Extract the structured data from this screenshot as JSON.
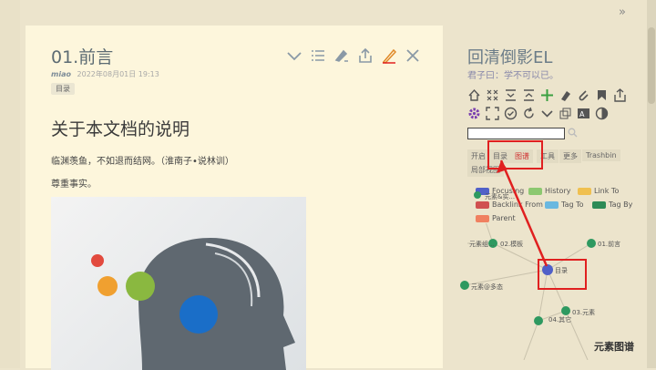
{
  "note": {
    "title": "01.前言",
    "author": "miao",
    "date": "2022年08月01日 19:13",
    "tag": "目录",
    "heading": "关于本文档的说明",
    "paragraphs": [
      "临渊羡鱼，不如退而结网。（淮南子•说林训）",
      "尊重事实。"
    ]
  },
  "sidebar": {
    "title": "回清倒影EL",
    "subtitle": "君子曰：学不可以已。",
    "tabs": [
      "开启",
      "目录",
      "图谱",
      "工具",
      "更多",
      "Trashbin",
      "局部视图"
    ],
    "active_tab": "图谱"
  },
  "legend": [
    {
      "label": "Focusing",
      "color": "#5060c8"
    },
    {
      "label": "History",
      "color": "#8cc870"
    },
    {
      "label": "Link To",
      "color": "#f0c050"
    },
    {
      "label": "Backlink From",
      "color": "#d05050"
    },
    {
      "label": "Tag To",
      "color": "#6ab8e0"
    },
    {
      "label": "Tag By",
      "color": "#2e8b57"
    },
    {
      "label": "Parent",
      "color": "#f08060"
    }
  ],
  "graph": {
    "nodes": [
      "元素&实...",
      "元素组...",
      "02.模板",
      "01.前言",
      "目录",
      "元素@多态",
      "03.元素",
      "04.其它"
    ],
    "watermark": "元素图谱"
  }
}
